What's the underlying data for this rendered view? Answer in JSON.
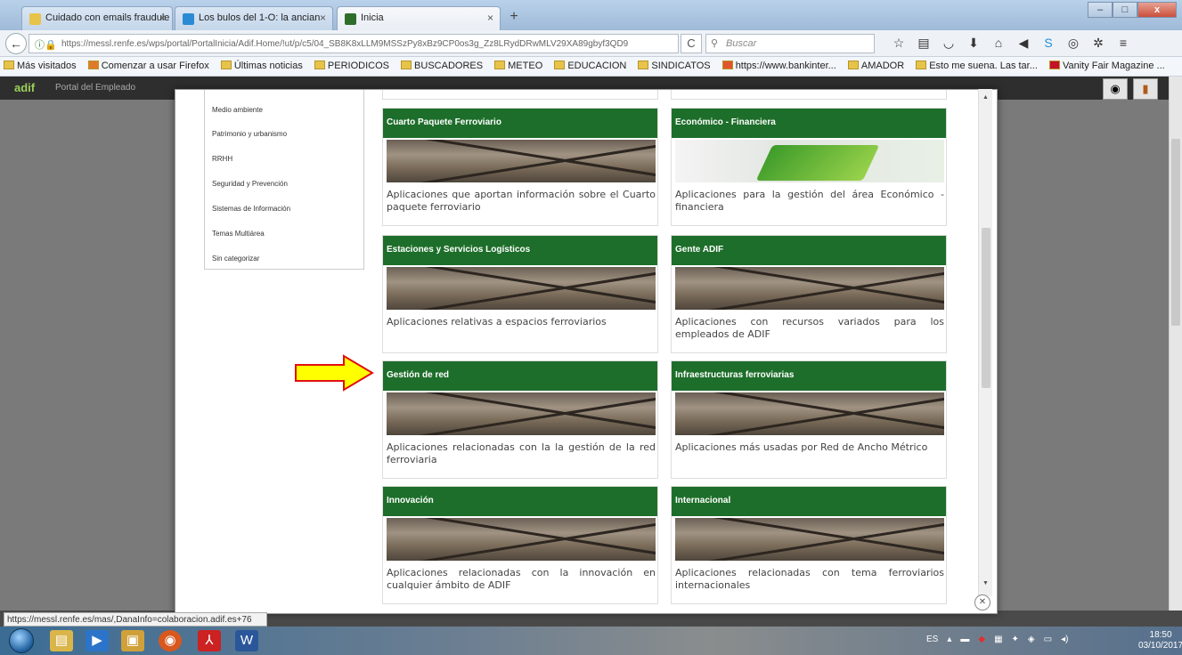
{
  "browser": {
    "tabs": [
      {
        "title": "Cuidado con emails fraudule",
        "favicon_color": "#e8c34a"
      },
      {
        "title": "Los bulos del 1-O: la ancian",
        "favicon_color": "#2a8ad4"
      },
      {
        "title": "Inicia",
        "favicon_color": "#2e6e2a"
      }
    ],
    "new_tab_label": "+",
    "url": "https://messl.renfe.es/wps/portal/PortalInicia/Adif.Home/!ut/p/c5/04_SB8K8xLLM9MSSzPy8xBz9CP0os3g_Zz8LRydDRwMLV29XA89gbyf3QD9",
    "search_placeholder": "Buscar",
    "window_controls": {
      "minimize": "–",
      "maximize": "□",
      "close": "x"
    }
  },
  "bookmarks": [
    "Más visitados",
    "Comenzar a usar Firefox",
    "Últimas noticias",
    "PERIODICOS",
    "BUSCADORES",
    "METEO",
    "EDUCACION",
    "SINDICATOS",
    "https://www.bankinter...",
    "AMADOR",
    "Esto me suena. Las tar...",
    "Vanity Fair Magazine ..."
  ],
  "portal": {
    "logo": "adif",
    "title": "Portal del Empleado"
  },
  "sidebar_categories": [
    "Medio ambiente",
    "Patrimonio y urbanismo",
    "RRHH",
    "Seguridad y Prevención",
    "Sistemas de Información",
    "Temas Multiárea",
    "Sin categorizar"
  ],
  "cards": [
    {
      "title": "Cuarto Paquete Ferroviario",
      "description": "Aplicaciones que aportan información sobre el Cuarto paquete ferroviario"
    },
    {
      "title": "Económico - Financiera",
      "description": "Aplicaciones para la gestión del área Económico - financiera"
    },
    {
      "title": "Estaciones y Servicios Logísticos",
      "description": "Aplicaciones relativas a espacios ferroviarios"
    },
    {
      "title": "Gente ADIF",
      "description": "Aplicaciones con recursos variados para los empleados de ADIF"
    },
    {
      "title": "Gestión de red",
      "description": "Aplicaciones relacionadas con la la gestión de la red ferroviaria"
    },
    {
      "title": "Infraestructuras ferroviarias",
      "description": "Aplicaciones más usadas por Red de Ancho Métrico"
    },
    {
      "title": "Innovación",
      "description": "Aplicaciones relacionadas con la innovación en cualquier ámbito de ADIF"
    },
    {
      "title": "Internacional",
      "description": "Aplicaciones relacionadas con tema ferroviarios internacionales"
    }
  ],
  "status_url": "https://messl.renfe.es/mas/,DanaInfo=colaboracion.adif.es+76",
  "taskbar": {
    "language": "ES",
    "time": "18:50",
    "date": "03/10/2017"
  },
  "colors": {
    "card_header": "#1d6e2a",
    "arrow_fill": "#ffff00",
    "arrow_stroke": "#e01010"
  }
}
